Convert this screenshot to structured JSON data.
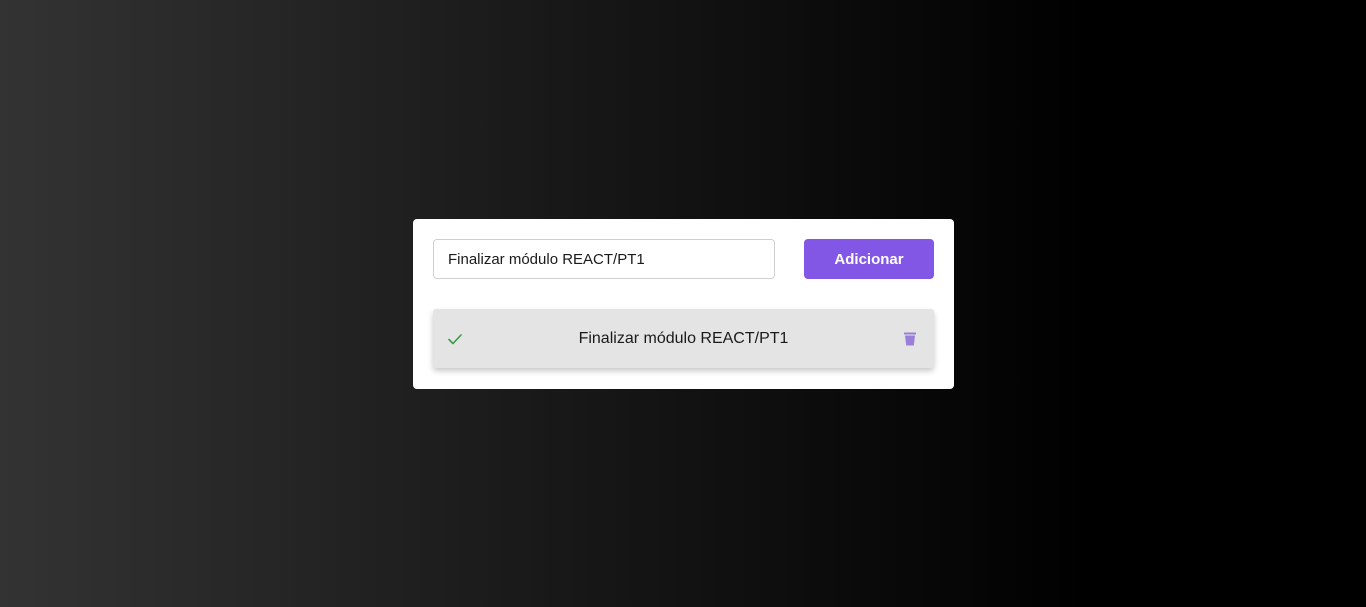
{
  "form": {
    "input_value": "Finalizar módulo REACT/PT1",
    "add_button_label": "Adicionar"
  },
  "todos": [
    {
      "text": "Finalizar módulo REACT/PT1",
      "completed": true,
      "check_icon": "check-icon",
      "delete_icon": "trash-icon"
    }
  ],
  "colors": {
    "accent": "#8257e5",
    "check": "#3a9b47",
    "trash": "#9a7fd8"
  }
}
